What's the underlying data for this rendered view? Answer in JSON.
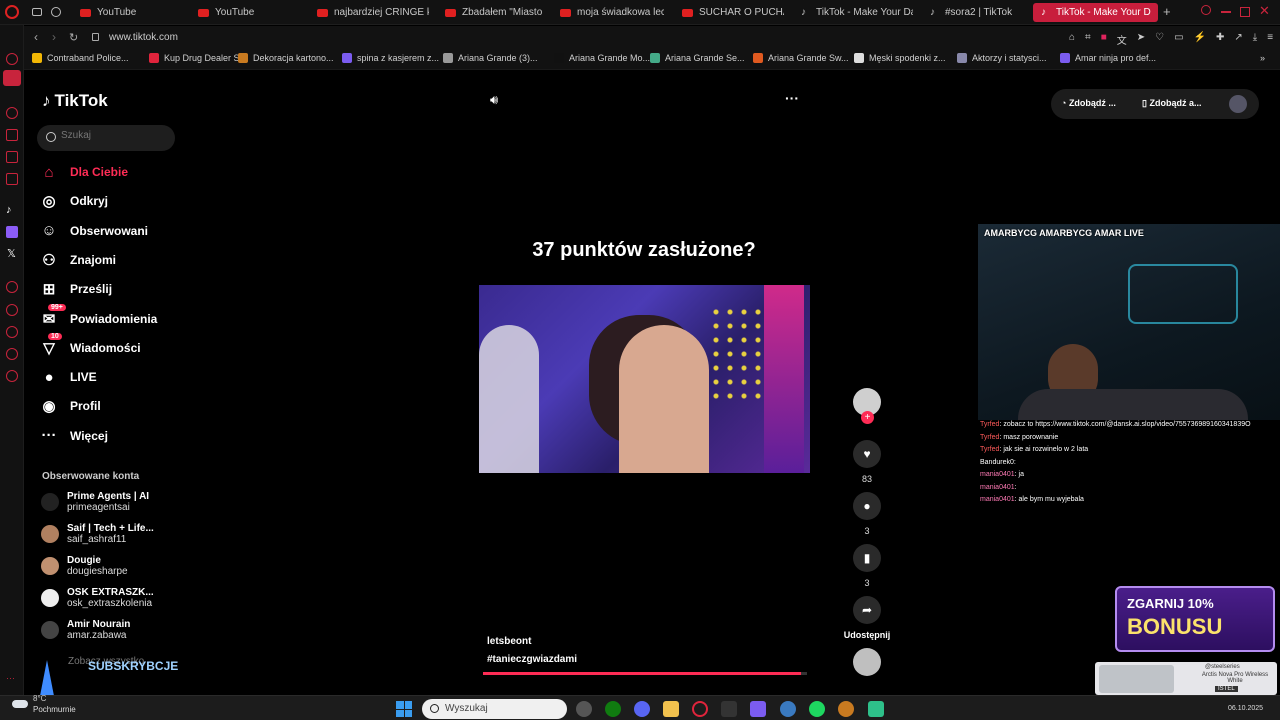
{
  "browser": {
    "tabs": [
      {
        "label": "YouTube",
        "icon": "youtube-icon"
      },
      {
        "label": "YouTube",
        "icon": "youtube-icon"
      },
      {
        "label": "najbardziej CRINGE kon",
        "icon": "youtube-icon"
      },
      {
        "label": "Zbadałem \"Miasto Mon",
        "icon": "youtube-icon"
      },
      {
        "label": "moja świadkowa leci n",
        "icon": "youtube-icon"
      },
      {
        "label": "SUCHAR O PUCHACZU",
        "icon": "youtube-icon"
      },
      {
        "label": "TikTok - Make Your Day",
        "icon": "tiktok-icon"
      },
      {
        "label": "#sora2 | TikTok",
        "icon": "tiktok-icon"
      },
      {
        "label": "TikTok - Make Your D",
        "icon": "tiktok-icon",
        "active": true
      }
    ],
    "url": "www.tiktok.com",
    "bookmarks": [
      {
        "label": "Contraband Police..."
      },
      {
        "label": "Kup Drug Dealer S..."
      },
      {
        "label": "Dekoracja kartono..."
      },
      {
        "label": "spina z kasjerem z..."
      },
      {
        "label": "Ariana Grande (3)..."
      },
      {
        "label": "Ariana Grande Mo..."
      },
      {
        "label": "Ariana Grande Se..."
      },
      {
        "label": "Ariana Grande Sw..."
      },
      {
        "label": "Męski spodenki z..."
      },
      {
        "label": "Aktorzy i statysci..."
      },
      {
        "label": "Amar ninja pro def..."
      }
    ],
    "accent": "#c81e3c"
  },
  "tiktok": {
    "logo": "TikTok",
    "search_placeholder": "Szukaj",
    "nav": [
      {
        "label": "Dla Ciebie",
        "icon": "home-icon",
        "active": true
      },
      {
        "label": "Odkryj",
        "icon": "compass-icon"
      },
      {
        "label": "Obserwowani",
        "icon": "following-icon"
      },
      {
        "label": "Znajomi",
        "icon": "friends-icon"
      },
      {
        "label": "Prześlij",
        "icon": "upload-icon"
      },
      {
        "label": "Powiadomienia",
        "icon": "bell-icon",
        "badge": "99+"
      },
      {
        "label": "Wiadomości",
        "icon": "messages-icon",
        "badge": "10"
      },
      {
        "label": "LIVE",
        "icon": "live-icon"
      },
      {
        "label": "Profil",
        "icon": "profile-icon"
      },
      {
        "label": "Więcej",
        "icon": "more-icon"
      }
    ],
    "following_heading": "Obserwowane konta",
    "following": [
      {
        "name": "Prime Agents | AI",
        "handle": "primeagentsai"
      },
      {
        "name": "Saif | Tech + Life...",
        "handle": "saif_ashraf11"
      },
      {
        "name": "Dougie",
        "handle": "dougiesharpe"
      },
      {
        "name": "OSK EXTRASZK...",
        "handle": "osk_extraszkolenia"
      },
      {
        "name": "Amir Nourain",
        "handle": "amar.zabawa"
      }
    ],
    "see_more": "Zobacz wszystko",
    "header_btn1": "Zdobądź ...",
    "header_btn2": "Zdobądź a...",
    "video_caption_title": "37 punktów zasłużone?",
    "author": "letsbeont",
    "hashtag": "#tanieczgwiazdami",
    "likes": "83",
    "comments": "3",
    "saves": "3",
    "share_label": "Udostępnij",
    "progress": 0.98
  },
  "stream": {
    "socials": "AMARBYCG  AMARBYCG  AMAR LIVE",
    "chat": [
      {
        "user": "Tyrfed",
        "text": "zobacz to https://www.tiktok.com/@dansk.ai.slop/video/755736989160341839O"
      },
      {
        "user": "Tyrfed",
        "text": "masz porownanie"
      },
      {
        "user": "Tyrfed",
        "text": "jak sie ai rozwinelo w 2 lata"
      },
      {
        "user": "Bandurek0",
        "text": ""
      },
      {
        "user": "mania0401",
        "text": "ja"
      },
      {
        "user": "mania0401",
        "text": ""
      },
      {
        "user": "mania0401",
        "text": "ale bym mu wyjebala"
      }
    ],
    "subscribe": "SUBSKRYBCJE",
    "promo": "ZGARNIJ 10%",
    "promo2": "BONUSU",
    "ad_brand": "@steelseries",
    "ad_text": "Arctis Nova Pro Wireless White",
    "ad_store": "ISTEL"
  },
  "taskbar": {
    "weather_temp": "8°C",
    "weather_desc": "Pochmurnie",
    "search": "Wyszukaj",
    "date": "06.10.2025"
  }
}
